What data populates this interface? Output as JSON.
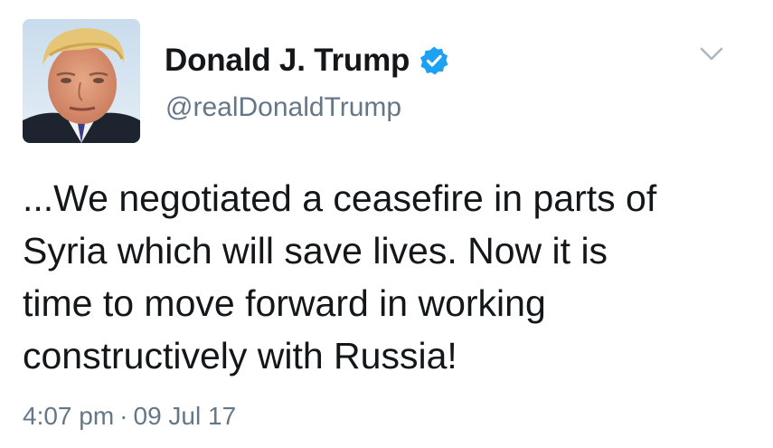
{
  "author": {
    "display_name": "Donald J. Trump",
    "handle": "@realDonaldTrump",
    "verified": true
  },
  "tweet": {
    "lines": [
      "...We negotiated a ceasefire in parts of",
      "Syria which will save lives. Now it is",
      "time to move forward in working",
      "constructively with Russia!"
    ]
  },
  "meta": {
    "time": "4:07 pm",
    "separator": "·",
    "date": "09 Jul 17"
  },
  "icons": {
    "verified": "verified-badge-icon",
    "menu": "chevron-down-icon"
  },
  "colors": {
    "text": "#14171a",
    "secondary": "#657786",
    "verified_blue": "#1da1f2",
    "chevron": "#aab8c2"
  }
}
